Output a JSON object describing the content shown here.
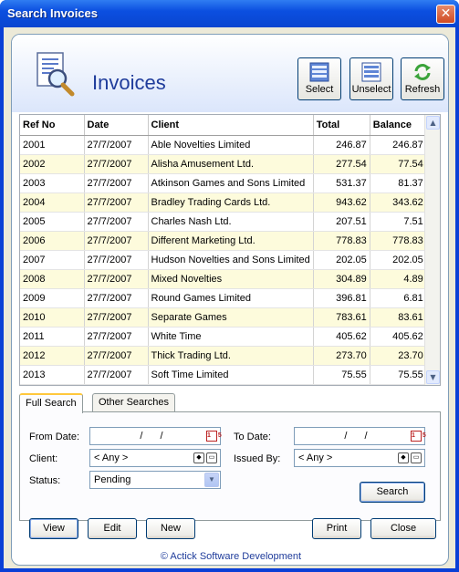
{
  "window": {
    "title": "Search Invoices",
    "close_glyph": "✕"
  },
  "header": {
    "title": "Invoices",
    "icon": "document-search-icon"
  },
  "toolbar": {
    "select_label": "Select",
    "unselect_label": "Unselect",
    "refresh_label": "Refresh"
  },
  "grid": {
    "columns": [
      "Ref No",
      "Date",
      "Client",
      "Total",
      "Balance"
    ],
    "rows": [
      [
        "2001",
        "27/7/2007",
        "Able Novelties Limited",
        "246.87",
        "246.87"
      ],
      [
        "2002",
        "27/7/2007",
        "Alisha Amusement Ltd.",
        "277.54",
        "77.54"
      ],
      [
        "2003",
        "27/7/2007",
        "Atkinson Games and Sons Limited",
        "531.37",
        "81.37"
      ],
      [
        "2004",
        "27/7/2007",
        "Bradley Trading Cards Ltd.",
        "943.62",
        "343.62"
      ],
      [
        "2005",
        "27/7/2007",
        "Charles Nash Ltd.",
        "207.51",
        "7.51"
      ],
      [
        "2006",
        "27/7/2007",
        "Different Marketing Ltd.",
        "778.83",
        "778.83"
      ],
      [
        "2007",
        "27/7/2007",
        "Hudson Novelties and Sons Limited",
        "202.05",
        "202.05"
      ],
      [
        "2008",
        "27/7/2007",
        "Mixed Novelties",
        "304.89",
        "4.89"
      ],
      [
        "2009",
        "27/7/2007",
        "Round Games Limited",
        "396.81",
        "6.81"
      ],
      [
        "2010",
        "27/7/2007",
        "Separate Games",
        "783.61",
        "83.61"
      ],
      [
        "2011",
        "27/7/2007",
        "White Time",
        "405.62",
        "405.62"
      ],
      [
        "2012",
        "27/7/2007",
        "Thick Trading Ltd.",
        "273.70",
        "23.70"
      ],
      [
        "2013",
        "27/7/2007",
        "Soft Time Limited",
        "75.55",
        "75.55"
      ]
    ]
  },
  "tabs": {
    "full_search": "Full Search",
    "other_searches": "Other Searches"
  },
  "search": {
    "from_date_label": "From Date:",
    "from_date_value": "/ /",
    "to_date_label": "To Date:",
    "to_date_value": "/ /",
    "calendar_glyph": "15",
    "client_label": "Client:",
    "client_value": "< Any >",
    "issued_by_label": "Issued By:",
    "issued_by_value": "< Any >",
    "status_label": "Status:",
    "status_value": "Pending",
    "search_button": "Search"
  },
  "actions": {
    "view": "View",
    "edit": "Edit",
    "new": "New",
    "print": "Print",
    "close": "Close"
  },
  "footer": {
    "text": "© Actick Software Development"
  }
}
